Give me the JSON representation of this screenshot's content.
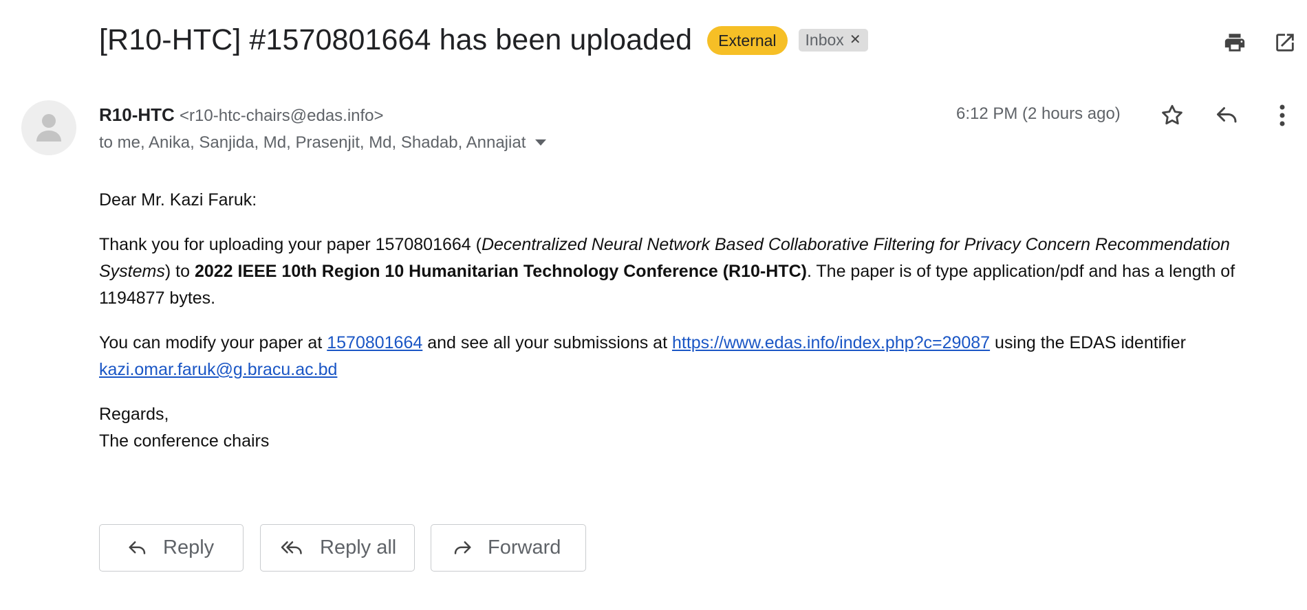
{
  "header": {
    "subject": "[R10-HTC] #1570801664 has been uploaded",
    "labels": {
      "external": "External",
      "inbox": "Inbox"
    },
    "remove_glyph": "✕"
  },
  "message": {
    "sender_name": "R10-HTC",
    "sender_email": "<r10-htc-chairs@edas.info>",
    "recipients": "to me, Anika, Sanjida, Md, Prasenjit, Md, Shadab, Annajiat",
    "time": "6:12 PM (2 hours ago)"
  },
  "body": {
    "greeting": "Dear Mr. Kazi Faruk:",
    "p1_a": "Thank you for uploading your paper 1570801664 (",
    "p1_title": "Decentralized Neural Network Based Collaborative Filtering for Privacy Concern Recommendation Systems",
    "p1_b": ") to ",
    "p1_conf": "2022 IEEE 10th Region 10 Humanitarian Technology Conference (R10-HTC)",
    "p1_c": ". The paper is of type application/pdf and has a length of 1194877 bytes.",
    "p2_a": "You can modify your paper at ",
    "p2_link1": "1570801664",
    "p2_b": " and see all your submissions at ",
    "p2_link2": "https://www.edas.info/index.php?c=29087",
    "p2_c": " using the EDAS identifier ",
    "p2_link3": "kazi.omar.faruk@g.bracu.ac.bd",
    "regards": "Regards,",
    "signoff": "The conference chairs"
  },
  "actions": {
    "reply": "Reply",
    "reply_all": "Reply all",
    "forward": "Forward"
  },
  "icons": {
    "print": "printer-icon",
    "open_new": "open-in-new-window-icon",
    "star": "star-icon",
    "reply": "reply-icon",
    "more": "more-vert-icon",
    "avatar": "person-icon",
    "dropdown": "dropdown-arrow-icon"
  },
  "colors": {
    "external_label": "#f6bf26",
    "inbox_label": "#dddddd",
    "link": "#1a56c5"
  }
}
